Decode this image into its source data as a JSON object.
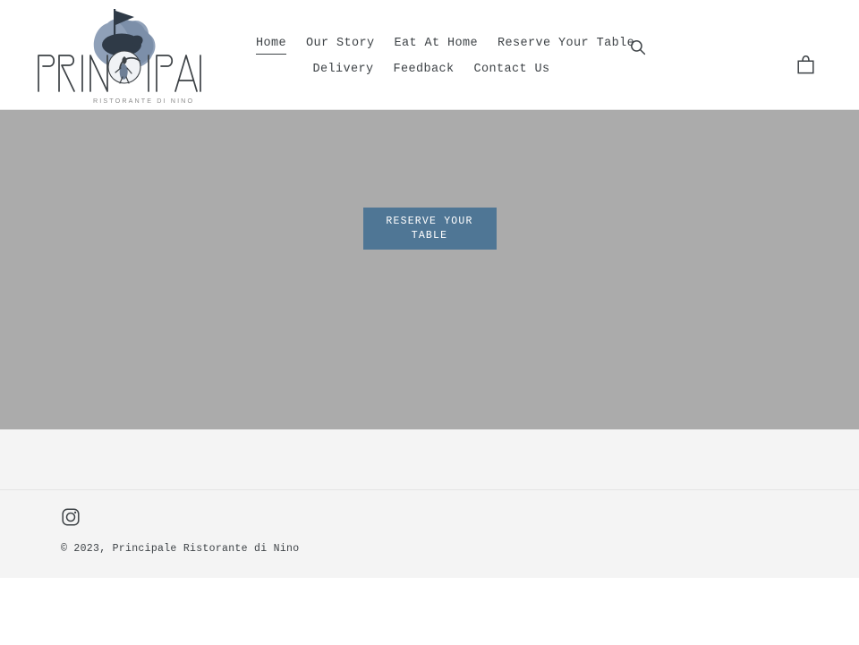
{
  "brand": {
    "wordmark": "PRINCIPALE",
    "tagline": "RISTORANTE DI NINO",
    "logo_icon": "mountain-flag-logo-icon",
    "logo_colors": {
      "rock_light": "#8fa0b8",
      "rock_mid": "#7c8fa9",
      "rock_dark": "#2f3a47",
      "wordmark": "#3d4246"
    },
    "home_link_title": "Principale Ristorante di Nino"
  },
  "nav": {
    "row_1": [
      {
        "label": "Home",
        "active": true
      },
      {
        "label": "Our Story",
        "active": false
      },
      {
        "label": "Eat At Home",
        "active": false
      },
      {
        "label": "Reserve Your Table",
        "active": false
      }
    ],
    "row_2": [
      {
        "label": "Delivery",
        "active": false
      },
      {
        "label": "Feedback",
        "active": false
      },
      {
        "label": "Contact Us",
        "active": false
      }
    ]
  },
  "header_actions": {
    "search": {
      "icon": "search-icon",
      "label": "Search"
    },
    "cart": {
      "icon": "shopping-bag-icon",
      "label": "Cart"
    }
  },
  "hero": {
    "background_color": "#ababab",
    "cta_label": "RESERVE YOUR TABLE",
    "cta_color": "#4f7695"
  },
  "sections": {
    "promo_band_color": "#f4f4f4"
  },
  "footer": {
    "background_color": "#f4f4f4",
    "social": [
      {
        "name": "Instagram",
        "icon": "instagram-icon"
      }
    ],
    "copyright": "© 2023, Principale Ristorante di Nino"
  }
}
